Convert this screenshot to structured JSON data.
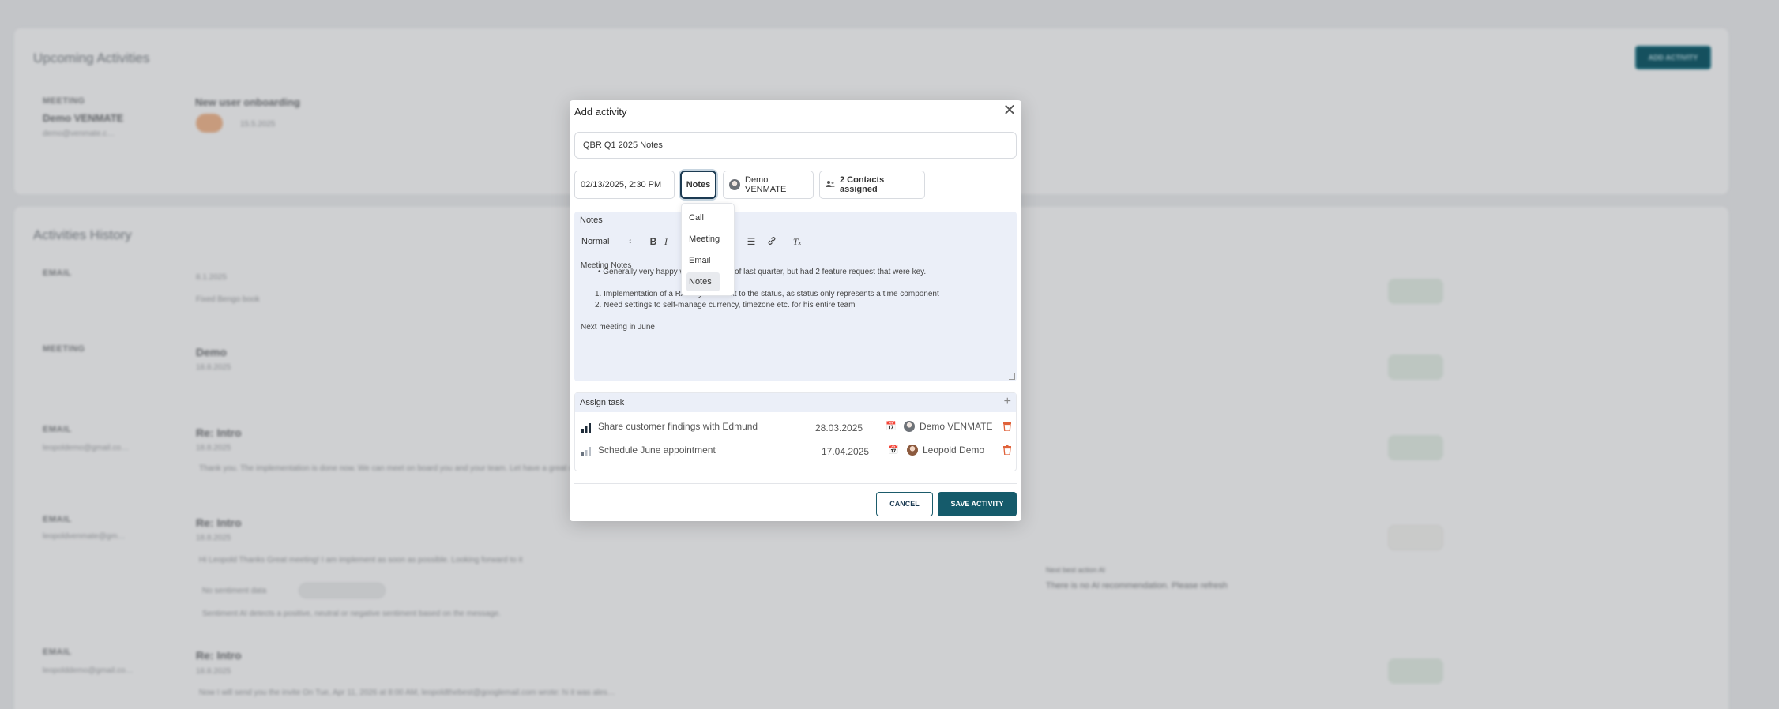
{
  "background": {
    "upcoming_title": "Upcoming Activities",
    "add_activity_button": "ADD ACTIVITY",
    "upcoming_item": {
      "type": "MEETING",
      "contact": "Demo VENMATE",
      "email": "demo@venmate.c…",
      "title": "New user onboarding",
      "date": "15.5.2025"
    },
    "history_title": "Activities History",
    "history_items": [
      {
        "type": "EMAIL",
        "title": "",
        "date": "8.1.2025",
        "body": "Fixed Bengo book"
      },
      {
        "type": "MEETING",
        "title": "Demo",
        "date": "18.8.2025",
        "body": ""
      },
      {
        "type": "EMAIL",
        "sub": "leopoldemo@gmail.co…",
        "title": "Re: Intro",
        "date": "18.8.2025",
        "body": "Thank you. The implementation is done now. We can meet on board you and your team. Let have a great day"
      },
      {
        "type": "EMAIL",
        "sub": "leopoldvenmate@gm…",
        "title": "Re: Intro",
        "date": "18.8.2025",
        "body": "Hi Leopold Thanks Great meeting! I am implement as soon as possible. Looking forward to it"
      },
      {
        "type": "EMAIL",
        "sub": "leopolddemo@gmail.co…",
        "title": "Re: Intro",
        "date": "18.8.2025",
        "body": "Now I will send you the invite On Tue, Apr 11, 2026 at 8:00 AM, leopoldthebest@googlemail.com wrote: hi it was ales…"
      }
    ],
    "sentiment_label": "No sentiment data",
    "sentiment_help": "Sentiment AI detects a positive, neutral or negative sentiment based on the message.",
    "next_action_label": "Next best action AI",
    "next_action_text": "There is no AI recommendation. Please refresh"
  },
  "modal": {
    "title": "Add activity",
    "activity_title": "QBR Q1 2025 Notes",
    "datetime": "02/13/2025, 2:30 PM",
    "selected_type": "Notes",
    "type_options": [
      "Call",
      "Meeting",
      "Email",
      "Notes"
    ],
    "owner": "Demo VENMATE",
    "contacts": "2 Contacts assigned",
    "notes_label": "Notes",
    "editor": {
      "format": "Normal",
      "heading": "Meeting Notes",
      "bullet": "Generally very happy with the results of last quarter, but had 2 feature request that were key.",
      "numbered": [
        "Implementation of a RAG system next to the status, as status only represents a time component",
        "Need settings to self-manage currency, timezone etc. for his entire team"
      ],
      "closing": "Next meeting in June"
    },
    "assign_task_label": "Assign task",
    "tasks": [
      {
        "name": "Share customer findings with Edmund",
        "date": "28.03.2025",
        "assignee": "Demo VENMATE"
      },
      {
        "name": "Schedule June appointment",
        "date": "17.04.2025",
        "assignee": "Leopold Demo"
      }
    ],
    "cancel_label": "CANCEL",
    "save_label": "SAVE ACTIVITY"
  },
  "colors": {
    "primary": "#155b6b",
    "delete": "#e0623a",
    "priority_dark": "#1f2c3a",
    "priority_light": "#b8bec6"
  }
}
